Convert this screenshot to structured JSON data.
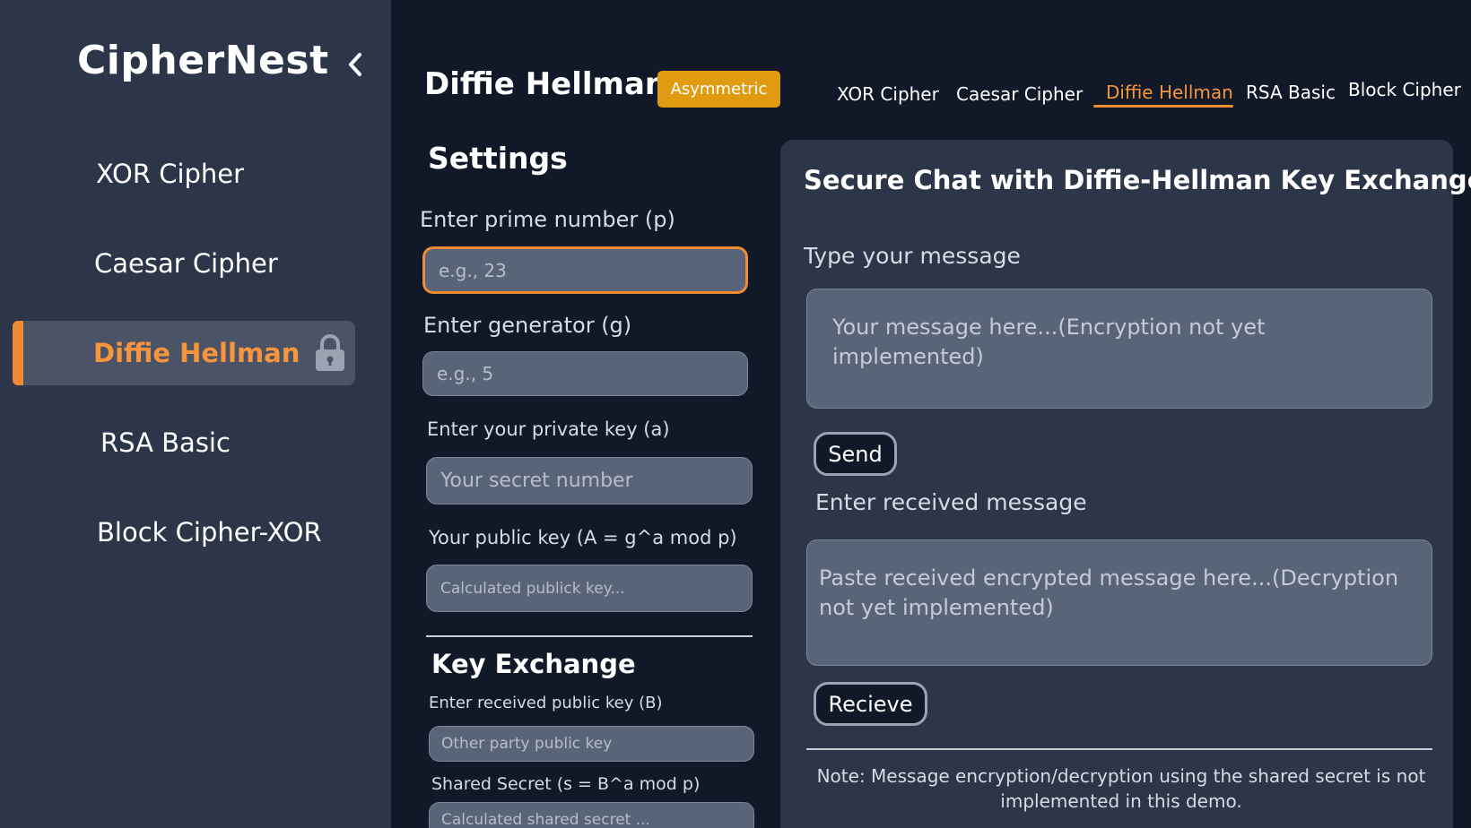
{
  "sidebar": {
    "brand": "CipherNest",
    "items": [
      {
        "label": "XOR Cipher"
      },
      {
        "label": "Caesar Cipher"
      },
      {
        "label": "Diffie Hellman"
      },
      {
        "label": "RSA Basic"
      },
      {
        "label": "Block Cipher-XOR"
      }
    ]
  },
  "header": {
    "title": "Diffie Hellman",
    "badge": "Asymmetric",
    "tabs": [
      {
        "label": "XOR Cipher"
      },
      {
        "label": "Caesar Cipher"
      },
      {
        "label": "Diffie Hellman"
      },
      {
        "label": "RSA Basic"
      },
      {
        "label": "Block Cipher"
      }
    ]
  },
  "settings": {
    "heading": "Settings",
    "prime_label": "Enter prime number (p)",
    "prime_placeholder": "e.g., 23",
    "generator_label": "Enter  generator (g)",
    "generator_placeholder": "e.g., 5",
    "private_label": "Enter your private key (a)",
    "private_placeholder": "Your secret number",
    "public_label": "Your public key (A = g^a mod p)",
    "public_placeholder": "Calculated publick key..."
  },
  "key_exchange": {
    "heading": "Key Exchange",
    "received_label": "Enter received public key (B)",
    "received_placeholder": "Other party public key",
    "shared_label": "Shared Secret (s = B^a mod p)",
    "shared_placeholder": "Calculated shared secret ..."
  },
  "chat": {
    "title": "Secure Chat with Diffie-Hellman Key Exchange",
    "message_label": "Type your message",
    "message_placeholder": "Your message here...(Encryption not yet implemented)",
    "send_label": "Send",
    "received_label": "Enter received message",
    "received_placeholder": "Paste received encrypted message here...(Decryption not yet implemented)",
    "receive_label": "Recieve",
    "note": "Note: Message encryption/decryption using the shared secret is not implemented in this demo."
  },
  "colors": {
    "accent": "#f08a33",
    "badge": "#e09b10",
    "background": "#111827",
    "sidebar": "#2c3648",
    "input": "#5a6479"
  },
  "icons": {
    "collapse": "chevron-left-icon",
    "locked": "lock-icon"
  }
}
